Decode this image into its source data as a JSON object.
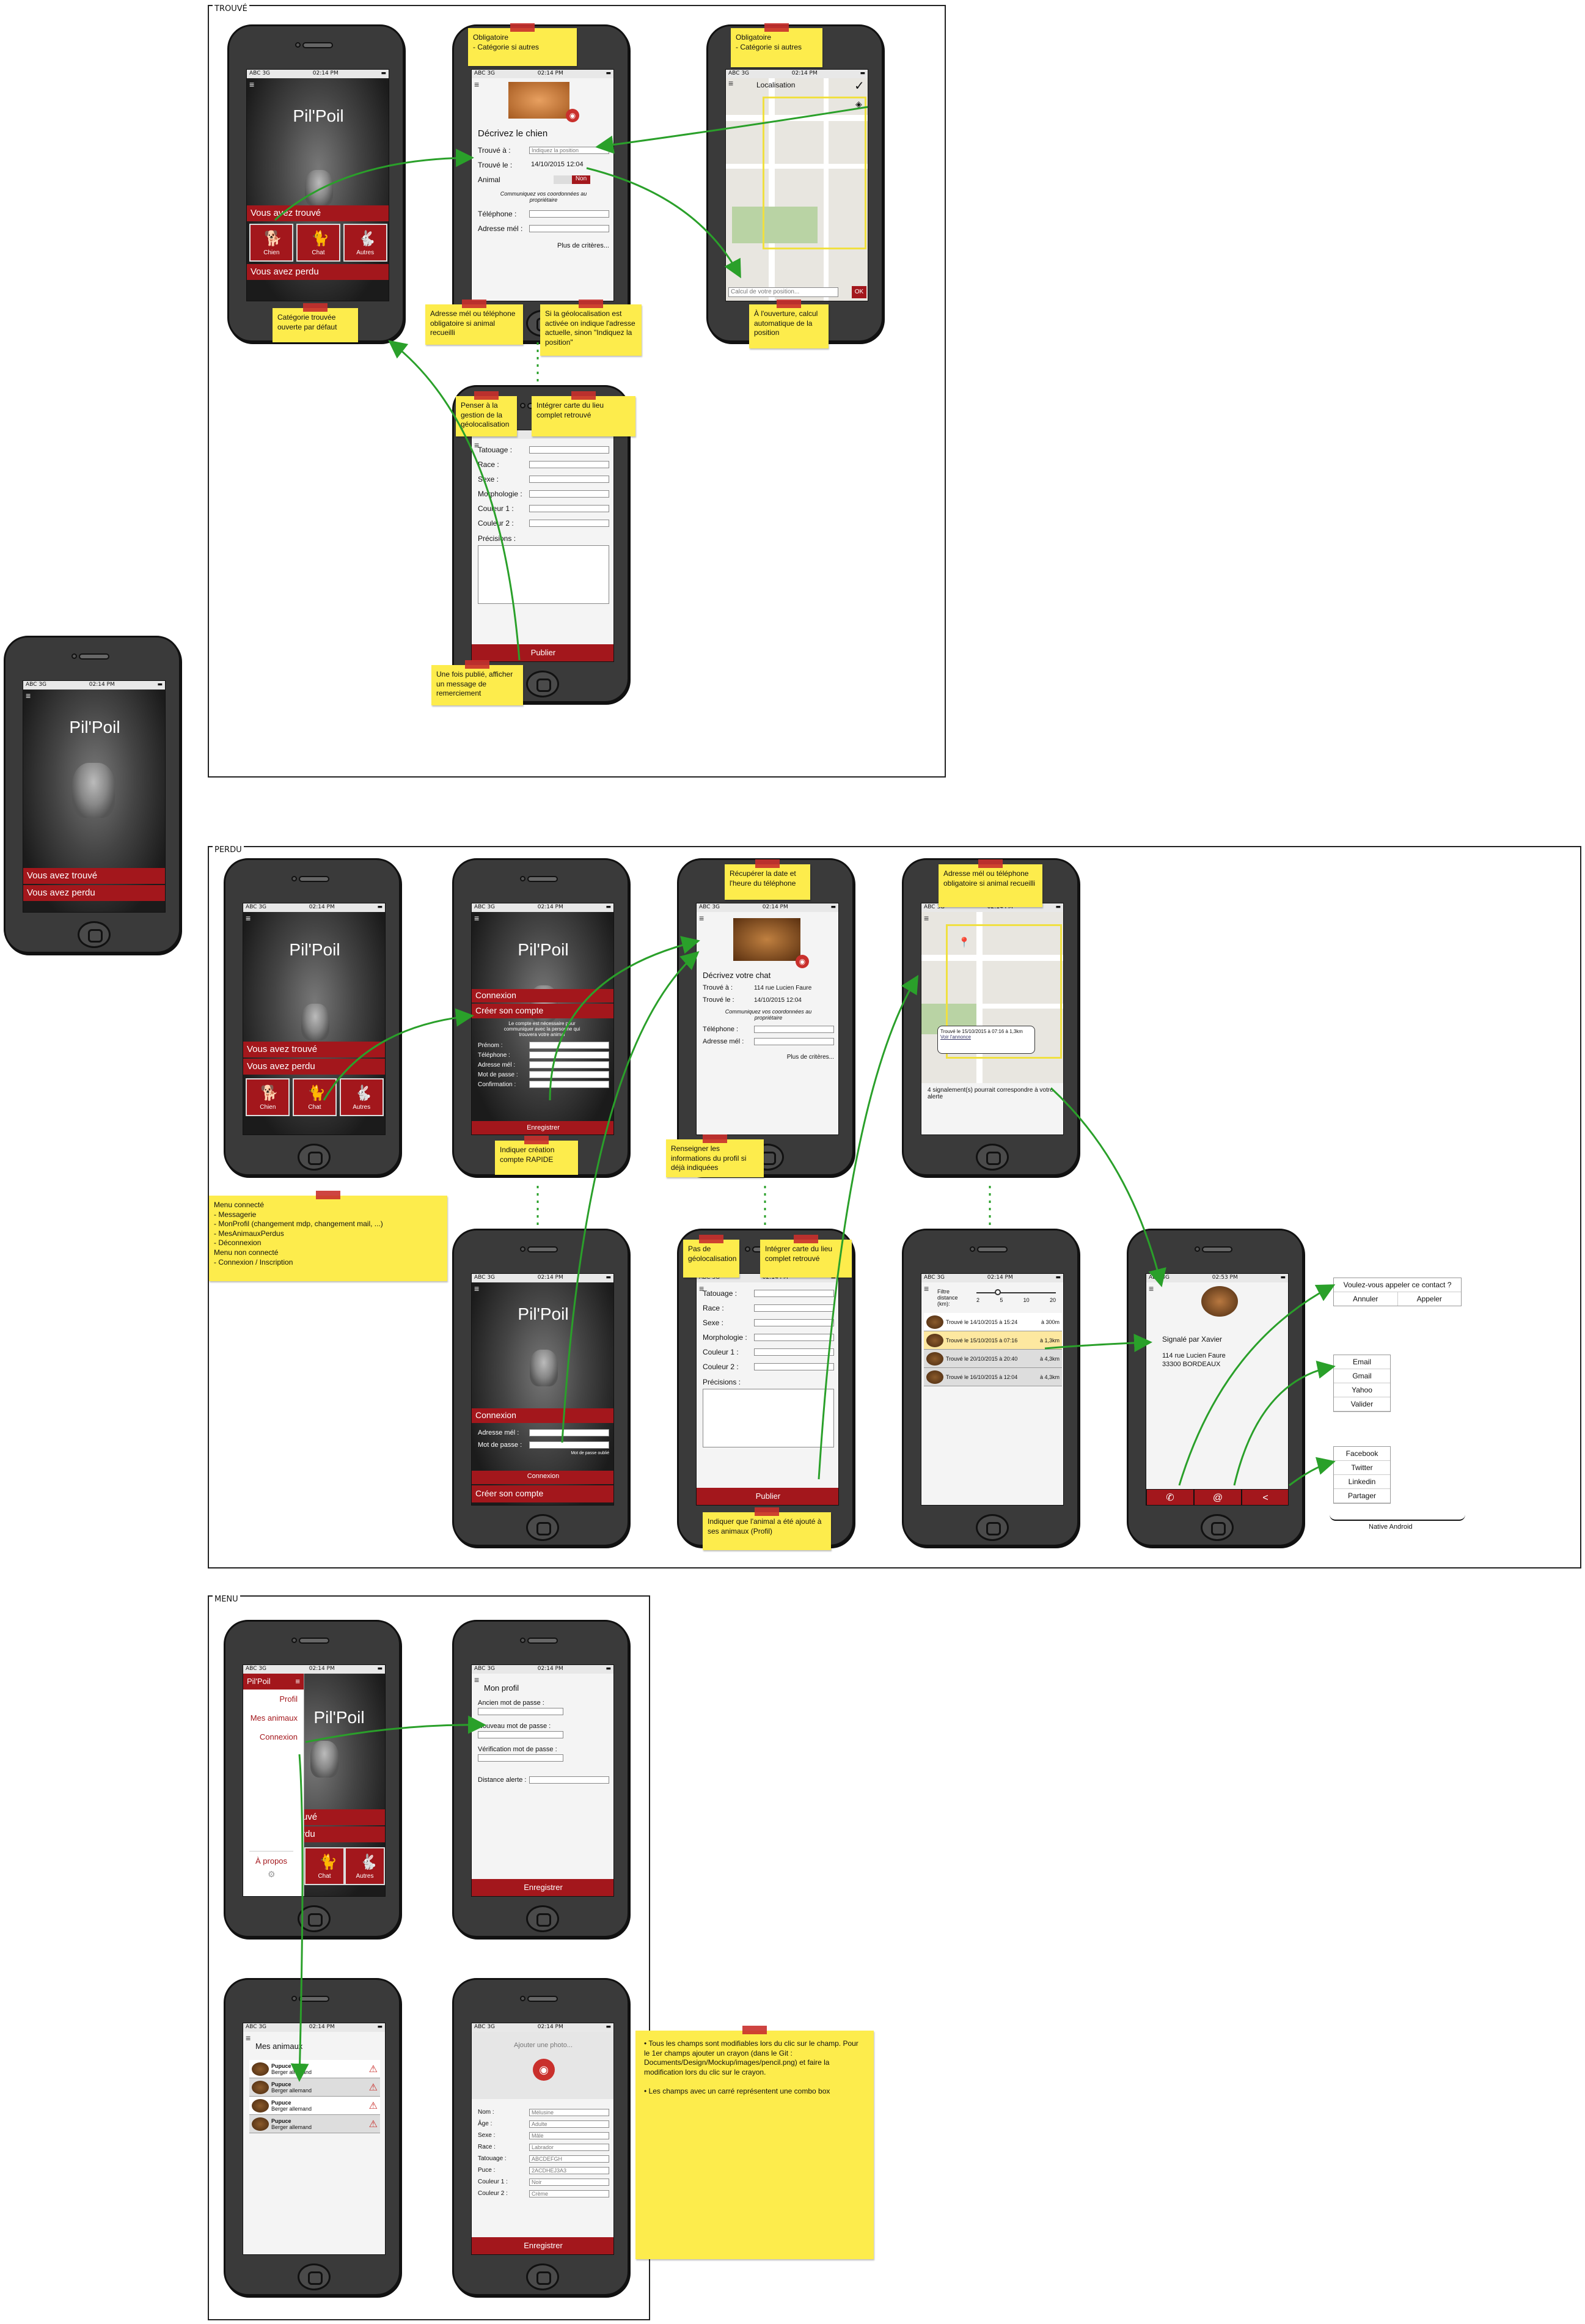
{
  "sections": {
    "trouve": "TROUVÉ",
    "perdu": "PERDU",
    "menu": "MENU"
  },
  "status": {
    "carrier": "ABC 3G",
    "time": "02:14 PM",
    "time_alt": "02:53 PM"
  },
  "app": {
    "title": "Pil'Poil",
    "found": "Vous avez trouvé",
    "lost": "Vous avez perdu",
    "tiles": [
      "Chien",
      "Chat",
      "Autres"
    ]
  },
  "found_form": {
    "title": "Décrivez le chien",
    "found_at": "Trouvé à :",
    "found_at_placeholder": "Indiquez la position",
    "found_on": "Trouvé le :",
    "date": "14/10/2015 12:04",
    "animal": "Animal",
    "toggle": "Non",
    "communicate": "Communiquez vos coordonnées au propriétaire",
    "phone": "Téléphone :",
    "email": "Adresse mél :",
    "more": "Plus de critères..."
  },
  "map_found": {
    "title": "Localisation",
    "input": "Calcul de votre position...",
    "ok": "OK"
  },
  "criteria": {
    "fields": [
      "Tatouage :",
      "Race :",
      "Sexe :",
      "Morphologie :",
      "Couleur 1 :",
      "Couleur 2 :"
    ],
    "precisions": "Précisions :",
    "publish": "Publier"
  },
  "notes_trouve": {
    "n1": "Obligatoire\n- Catégorie si autres",
    "n2": "Obligatoire\n- Catégorie si autres",
    "n3": "Catégorie trouvée ouverte par défaut",
    "n4": "Adresse mél ou téléphone obligatoire si animal recueilli",
    "n5": "Si la géolocalisation est activée on indique l'adresse actuelle, sinon \"Indiquez la position\"",
    "n6": "À l'ouverture, calcul automatique de la position",
    "n7": "Penser à la gestion de la géolocalisation",
    "n8": "Intégrer carte du lieu complet retrouvé",
    "n9": "Une fois publié, afficher un message de remerciement"
  },
  "login": {
    "connexion": "Connexion",
    "create": "Créer son compte",
    "info": "Le compte est nécessaire pour communiquer avec la personne qui trouvera votre animal",
    "fields": [
      "Prénom :",
      "Téléphone :",
      "Adresse mél :",
      "Mot de passe :",
      "Confirmation :"
    ],
    "save": "Enregistrer",
    "login_fields": [
      "Adresse mél :",
      "Mot de passe :"
    ],
    "forgot": "Mot de passe oublié"
  },
  "lost_form": {
    "title": "Décrivez votre chat",
    "found_at": "Trouvé à :",
    "address": "114 rue Lucien Faure",
    "found_on": "Trouvé le :",
    "date": "14/10/2015 12:04",
    "communicate": "Communiquez vos coordonnées au propriétaire",
    "phone": "Téléphone :",
    "email": "Adresse mél :",
    "more": "Plus de critères..."
  },
  "map_lost": {
    "popup1": "Trouvé le 15/10/2015 à 07:16",
    "popup2": "à 1,3km",
    "popup_link": "Voir l'annonce",
    "count": "4 signalement(s) pourrait correspondre à votre alerte"
  },
  "filter": {
    "label": "Filtre distance (km):",
    "ticks": [
      "2",
      "5",
      "10",
      "20"
    ],
    "rows": [
      {
        "t": "Trouvé le 14/10/2015 à 15:24",
        "d": "à 300m"
      },
      {
        "t": "Trouvé le 15/10/2015 à 07:16",
        "d": "à 1,3km"
      },
      {
        "t": "Trouvé le 20/10/2015 à 20:40",
        "d": "à 4,3km"
      },
      {
        "t": "Trouvé le 16/10/2015 à 12:04",
        "d": "à 4,3km"
      }
    ]
  },
  "contact": {
    "by": "Signalé par Xavier",
    "addr1": "114 rue Lucien Faure",
    "addr2": "33300 BORDEAUX"
  },
  "popups": {
    "call_q": "Voulez-vous appeler ce contact ?",
    "cancel": "Annuler",
    "call": "Appeler",
    "mail": [
      "Email",
      "Gmail",
      "Yahoo",
      "Valider"
    ],
    "share": [
      "Facebook",
      "Twitter",
      "Linkedin",
      "Partager"
    ],
    "native": "Native Android"
  },
  "notes_perdu": {
    "m1": "Menu connecté\n- Messagerie\n- MonProfil (changement mdp, changement mail, ...)\n- MesAnimauxPerdus\n- Déconnexion\nMenu non connecté\n- Connexion / Inscription",
    "m2": "Indiquer création compte RAPIDE",
    "m3": "Récupérer la date et l'heure du téléphone",
    "m4": "Renseigner les informations du profil si déjà indiquées",
    "m5": "Adresse mél ou téléphone obligatoire si animal recueilli",
    "m6": "Pas de géolocalisation",
    "m7": "Intégrer carte du lieu complet retrouvé",
    "m8": "Indiquer que l'animal a été ajouté à ses animaux (Profil)"
  },
  "menu": {
    "items": [
      "Profil",
      "Mes animaux",
      "Connexion"
    ],
    "about": "À propos"
  },
  "profile": {
    "title": "Mon profil",
    "old": "Ancien mot de passe :",
    "new": "Nouveau mot de passe :",
    "verify": "Vérification mot de passe :",
    "distance": "Distance alerte :",
    "save": "Enregistrer"
  },
  "animals": {
    "title": "Mes animaux",
    "rows": [
      {
        "n": "Pupuce",
        "s": "Berger allemand"
      },
      {
        "n": "Pupuce",
        "s": "Berger allemand"
      },
      {
        "n": "Pupuce",
        "s": "Berger allemand"
      },
      {
        "n": "Pupuce",
        "s": "Berger allemand"
      }
    ]
  },
  "animal_edit": {
    "add_photo": "Ajouter une photo...",
    "fields": [
      [
        "Nom :",
        "Mélusine"
      ],
      [
        "Âge :",
        "Adulte"
      ],
      [
        "Sexe :",
        "Mâle"
      ],
      [
        "Race :",
        "Labrador"
      ],
      [
        "Tatouage :",
        "ABCDEFGH"
      ],
      [
        "Puce :",
        "2ACDHEJ3A3"
      ],
      [
        "Couleur 1 :",
        "Noir"
      ],
      [
        "Couleur 2 :",
        "Crème"
      ]
    ],
    "save": "Enregistrer"
  },
  "note_menu": "• Tous les champs sont modifiables lors du clic sur le champ. Pour le 1er champs ajouter un crayon (dans le Git : Documents/Design/Mockup/images/pencil.png) et faire la modification lors du clic sur le crayon.\n\n• Les champs avec un carré représentent une combo box"
}
